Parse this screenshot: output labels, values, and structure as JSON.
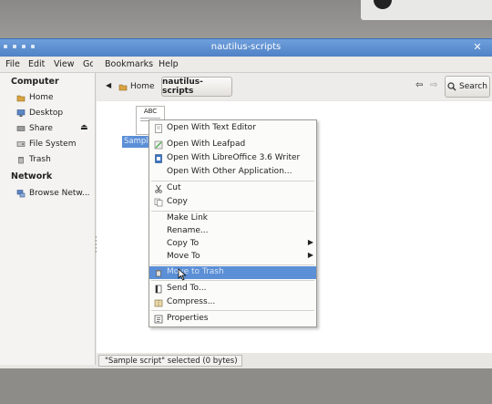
{
  "window": {
    "title": "nautilus-scripts",
    "close": "✕"
  },
  "menubar": [
    "File",
    "Edit",
    "View",
    "Go",
    "Bookmarks",
    "Help"
  ],
  "toolbar": {
    "home": "Home",
    "current": "nautilus-scripts",
    "search": "Search"
  },
  "sidebar": {
    "computer_header": "Computer",
    "computer_items": [
      "Home",
      "Desktop",
      "Share",
      "File System",
      "Trash"
    ],
    "network_header": "Network",
    "network_items": [
      "Browse Netw..."
    ]
  },
  "file": {
    "thumb_text": "ABC",
    "name": "Sample"
  },
  "context_menu": {
    "items": [
      {
        "label": "Open With Text Editor",
        "icon": "text-editor-icon"
      },
      {
        "label": "Open With Leafpad",
        "icon": "leafpad-icon"
      },
      {
        "label": "Open With LibreOffice 3.6 Writer",
        "icon": "writer-icon"
      },
      {
        "label": "Open With Other Application..."
      },
      {
        "label": "Cut",
        "icon": "scissors-icon"
      },
      {
        "label": "Copy",
        "icon": "copy-icon"
      },
      {
        "label": "Make Link"
      },
      {
        "label": "Rename..."
      },
      {
        "label": "Copy To"
      },
      {
        "label": "Move To"
      },
      {
        "label": "Move to Trash",
        "icon": "trash-icon"
      },
      {
        "label": "Send To...",
        "icon": "send-icon"
      },
      {
        "label": "Compress...",
        "icon": "compress-icon"
      },
      {
        "label": "Properties",
        "icon": "properties-icon"
      }
    ],
    "submenu_arrow": "▶",
    "highlighted": "Move to Trash"
  },
  "status": {
    "text": "\"Sample script\" selected (0 bytes)"
  },
  "colors": {
    "selection": "#5b8fd6",
    "titlebar": "#4f82c6",
    "folder": "#d9a441"
  }
}
